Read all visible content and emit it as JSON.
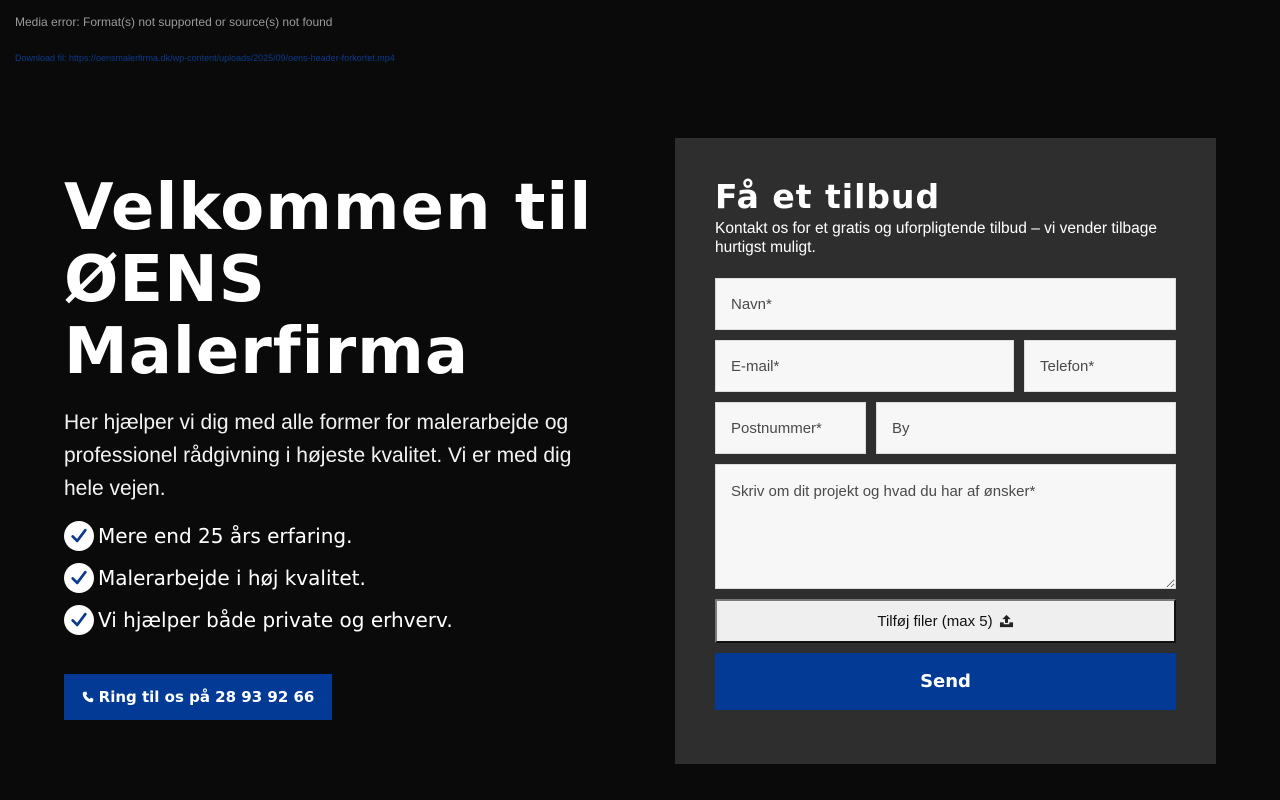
{
  "media": {
    "error_text": "Media error: Format(s) not supported or source(s) not found",
    "download_text": "Download fil: https://oensmalerfirma.dk/wp-content/uploads/2025/09/oens-header-forkortet.mp4"
  },
  "hero": {
    "title_line1": "Velkommen til",
    "title_line2": "ØENS",
    "title_line3": "Malerfirma",
    "lead": "Her hjælper vi dig med alle former for malerarbejde og professionel rådgivning i højeste kvalitet. Vi er med dig hele vejen.",
    "features": [
      "Mere end 25 års erfaring.",
      "Malerarbejde i høj kvalitet.",
      "Vi hjælper både private og erhverv."
    ],
    "call_button": "Ring til os på 28 93 92 66"
  },
  "form": {
    "title": "Få et tilbud",
    "intro": "Kontakt os for et gratis og uforpligtende tilbud – vi vender tilbage hurtigst muligt.",
    "name_placeholder": "Navn*",
    "email_placeholder": "E-mail*",
    "phone_placeholder": "Telefon*",
    "zip_placeholder": "Postnummer*",
    "city_placeholder": "By",
    "message_placeholder": "Skriv om dit projekt og hvad du har af ønsker*",
    "file_button": "Tilføj filer (max 5)",
    "send_button": "Send"
  },
  "colors": {
    "background": "#0a0a0a",
    "card": "#2e2e2e",
    "accent": "#023a96",
    "check_mark": "#0a3a8a"
  },
  "icons": {
    "feature": "check-circle-icon",
    "call": "phone-icon",
    "file": "upload-icon"
  }
}
